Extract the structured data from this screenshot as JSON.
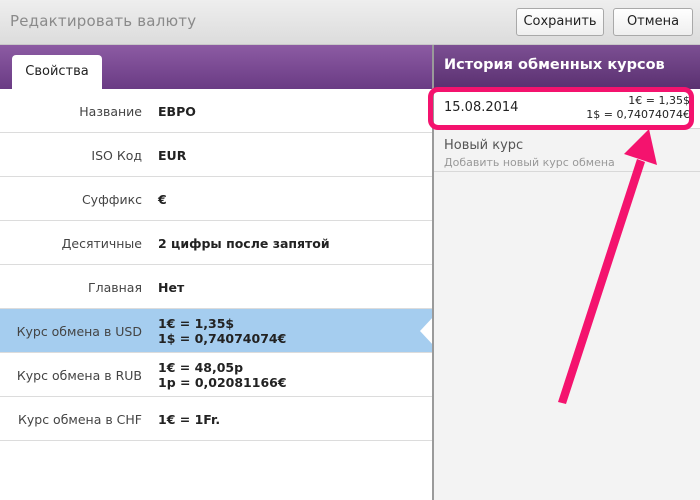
{
  "window": {
    "title": "Редактировать валюту",
    "save_label": "Сохранить",
    "cancel_label": "Отмена"
  },
  "tabs": [
    {
      "label": "Свойства",
      "active": true
    }
  ],
  "properties": [
    {
      "label": "Название",
      "values": [
        "ЕВРО"
      ]
    },
    {
      "label": "ISO Код",
      "values": [
        "EUR"
      ]
    },
    {
      "label": "Суффикс",
      "values": [
        "€"
      ]
    },
    {
      "label": "Десятичные",
      "values": [
        "2 цифры после запятой"
      ]
    },
    {
      "label": "Главная",
      "values": [
        "Нет"
      ]
    },
    {
      "label": "Курс обмена в USD",
      "values": [
        "1€ = 1,35$",
        "1$ = 0,74074074€"
      ],
      "selected": true
    },
    {
      "label": "Курс обмена в RUB",
      "values": [
        "1€ = 48,05р",
        "1р = 0,02081166€"
      ]
    },
    {
      "label": "Курс обмена в CHF",
      "values": [
        "1€ = 1Fr."
      ]
    }
  ],
  "history": {
    "title": "История обменных курсов",
    "items": [
      {
        "date": "15.08.2014",
        "rate1": "1€ = 1,35$",
        "rate2": "1$ = 0,74074074€"
      }
    ],
    "new_rate": {
      "title": "Новый курс",
      "subtitle": "Добавить новый курс обмена"
    }
  },
  "colors": {
    "accent_purple": "#6a3b84",
    "selection_blue": "#a5cdef",
    "annotation_pink": "#f4136e"
  }
}
